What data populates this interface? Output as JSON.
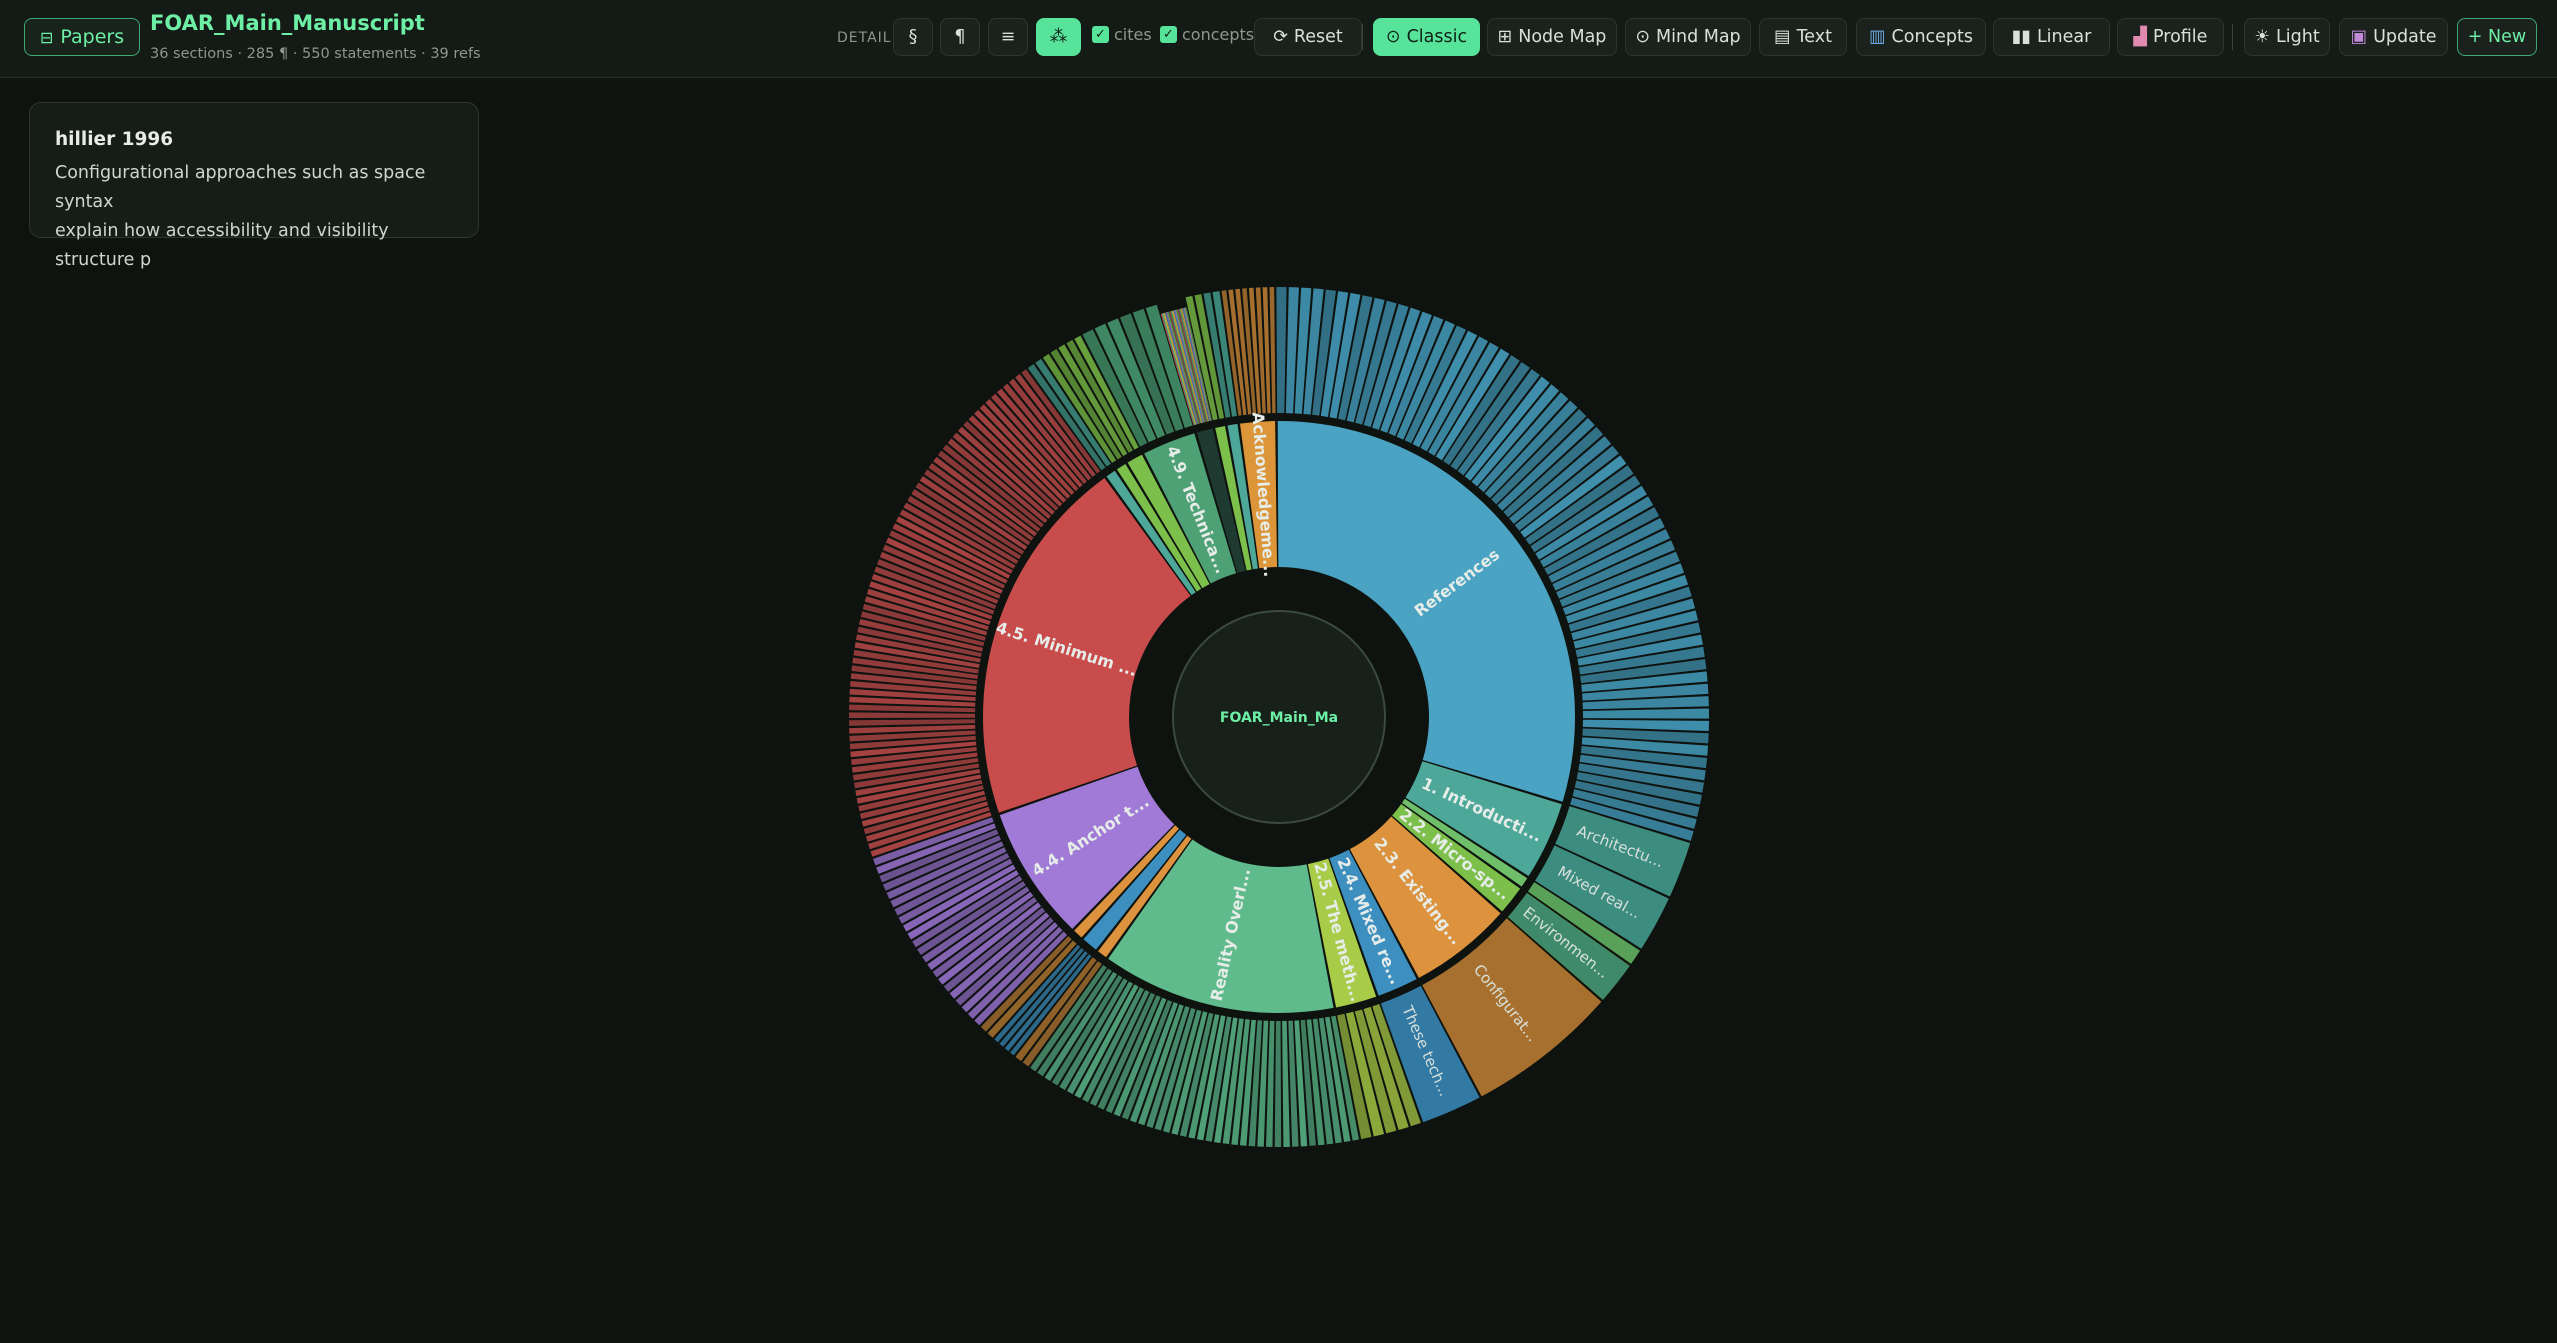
{
  "header": {
    "papers_button": "Papers",
    "title": "FOAR_Main_Manuscript",
    "meta": "36 sections · 285 ¶ · 550 statements · 39 refs"
  },
  "toolbar": {
    "detail_label": "DETAIL",
    "section_symbol": "§",
    "paragraph_symbol": "¶",
    "statements_symbol": "≡",
    "cites_label": "cites",
    "concepts_toggle_label": "concepts",
    "reset": "Reset",
    "classic": "Classic",
    "node_map": "Node Map",
    "mind_map": "Mind Map",
    "text": "Text",
    "concepts": "Concepts",
    "linear": "Linear",
    "profile": "Profile",
    "light": "Light",
    "update": "Update",
    "new": "+ New"
  },
  "tooltip": {
    "title": "hillier 1996",
    "line1": "Configurational approaches such as space syntax",
    "line2": "explain how accessibility and visibility structure p"
  },
  "icons": {
    "papers": "grid-icon",
    "reset": "refresh-icon",
    "classic": "target-icon",
    "node_map": "grid-icon",
    "mind_map": "circle-dot-icon",
    "text": "document-icon",
    "concepts": "books-icon",
    "linear": "columns-icon",
    "profile": "bar-chart-icon",
    "light": "sun-icon",
    "update": "floppy-disk-icon",
    "graph_view": "cluster-icon"
  },
  "colors": {
    "accent": "#58e39a",
    "background": "#0f130f",
    "references": "#4aa3c2",
    "introduction": "#4ea89a",
    "micro_spatial": "#7cc04b",
    "existing": "#dd923e",
    "mixed_reality": "#3d8fc0",
    "method": "#a9cc48",
    "reality_overlay": "#5fbb8c",
    "anchor": "#a07ad6",
    "minimum": "#c94c4c",
    "technical": "#4ea075",
    "acknowledgements": "#dc9538"
  },
  "sunburst": {
    "center_label": "FOAR_Main_Ma",
    "sections": [
      {
        "label": "References",
        "value": 88,
        "color": "#4aa3c2",
        "children": 65,
        "childColor": "#3f8fad"
      },
      {
        "label": "1. Introducti...",
        "value": 13,
        "color": "#4ea89a",
        "children": 4,
        "childColor": "#3d8c80"
      },
      {
        "label": "",
        "value": 2,
        "color": "#6fbf6a",
        "children": 1,
        "childColor": "#5aa35a"
      },
      {
        "label": "2.2. Micro-sp...",
        "value": 5,
        "color": "#7cc04b",
        "children": 3,
        "childColor": "#6aa53e"
      },
      {
        "label": "2.3. Existing...",
        "value": 17,
        "color": "#dd923e",
        "children": 10,
        "childColor": "#a8702f"
      },
      {
        "label": "2.4. Mixed re...",
        "value": 7,
        "color": "#3d8fc0",
        "children": 4,
        "childColor": "#327aa3"
      },
      {
        "label": "2.5. The meth...",
        "value": 7,
        "color": "#a9cc48",
        "children": 5,
        "childColor": "#92b13d"
      },
      {
        "label": "Reality Overl...",
        "value": 38,
        "color": "#5fbb8c",
        "children": 40,
        "childColor": "#4f9f78"
      },
      {
        "label": "",
        "value": 2,
        "color": "#dd923e",
        "children": 2,
        "childColor": "#a8702f"
      },
      {
        "label": "",
        "value": 3,
        "color": "#3d8fc0",
        "children": 4,
        "childColor": "#327aa3"
      },
      {
        "label": "",
        "value": 2,
        "color": "#dd923e",
        "children": 2,
        "childColor": "#a8702f"
      },
      {
        "label": "4.4. Anchor t...",
        "value": 22,
        "color": "#a07ad6",
        "children": 22,
        "childColor": "#8a68bb"
      },
      {
        "label": "4.5. Minimum ...",
        "value": 60,
        "color": "#c94c4c",
        "children": 70,
        "childColor": "#a84343"
      },
      {
        "label": "",
        "value": 2,
        "color": "#4ea89a",
        "children": 2,
        "childColor": "#3d8c80"
      },
      {
        "label": "",
        "value": 2,
        "color": "#7cc04b",
        "children": 2,
        "childColor": "#6aa53e"
      },
      {
        "label": "",
        "value": 3,
        "color": "#7cc04b",
        "children": 3,
        "childColor": "#6aa53e"
      },
      {
        "label": "4.9. Technica...",
        "value": 9,
        "color": "#4ea075",
        "children": 6,
        "childColor": "#3f8a64"
      },
      {
        "label": "",
        "value": 3,
        "color": "#1f3a30",
        "children": 24,
        "childColor": "#5b7a62"
      },
      {
        "label": "",
        "value": 2,
        "color": "#7cc04b",
        "children": 2,
        "childColor": "#6aa53e"
      },
      {
        "label": "",
        "value": 2,
        "color": "#4ea89a",
        "children": 2,
        "childColor": "#3d8c80"
      },
      {
        "label": "Acknowledgeme...",
        "value": 6,
        "color": "#dc9538",
        "children": 8,
        "childColor": "#a8702f"
      }
    ],
    "outer_labels": [
      {
        "label": "Architectu...",
        "section": 1,
        "color": "#3d8c80"
      },
      {
        "label": "Mixed real...",
        "section": 1,
        "color": "#3d8c80"
      },
      {
        "label": "Environmen...",
        "section": 3,
        "color": "#3f8a6a"
      },
      {
        "label": "Configurat...",
        "section": 4,
        "color": "#a8702f"
      },
      {
        "label": "These tech...",
        "section": 5,
        "color": "#327aa3"
      }
    ]
  }
}
